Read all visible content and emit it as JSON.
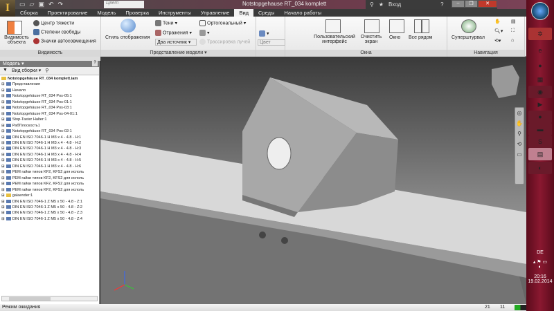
{
  "titlebar": {
    "app_icon": "I",
    "title": "Notstopgehause RT_034 komplett",
    "qat_combo": "Цвет",
    "help_search": "Вход"
  },
  "tabs": [
    "Сборка",
    "Проектирование",
    "Модель",
    "Проверка",
    "Инструменты",
    "Управление",
    "Вид",
    "Среды",
    "Начало работы"
  ],
  "active_tab": "Вид",
  "ribbon": {
    "visibility": {
      "title": "Видимость",
      "object_vis": "Видимость объекта",
      "center": "Центр тяжести",
      "dof": "Степени свободы",
      "icons": "Значки автосовмещения"
    },
    "appearance": {
      "title": "Представление модели",
      "style": "Стиль отображения",
      "shadows": "Тени",
      "reflections": "Отражения",
      "lights": "Два источник",
      "ortho": "Ортогональный",
      "raytrace": "Трассировка лучей",
      "color": "Цвет"
    },
    "windows": {
      "title": "Окна",
      "ui": "Пользовательский интерфейс",
      "clean": "Очистить экран",
      "window": "Окно",
      "tile": "Все рядом"
    },
    "navigation": {
      "title": "Навигация",
      "wheel": "Суперштурвал"
    }
  },
  "browser": {
    "title": "Модель",
    "view": "Вид сборки",
    "items": [
      "Notstopgehäuse RT_034 komplett.iam",
      "Представления",
      "Начало",
      "Notstopgehäuse RT_034 Pos-05:1",
      "Notstopgehäuse RT_034 Pos-01:1",
      "Notstopgehäuse RT_034 Pos-03:1",
      "Notstopgehäuse RT_034 Pos-04-01:1",
      "Stop-Taster Halter:1",
      "РабПлоскость1",
      "Notstopgehäuse RT_034 Pos-02:1",
      "DIN EN ISO 7046-1 H M3 x 4 - 4.8 - H:1",
      "DIN EN ISO 7046-1 H M3 x 4 - 4.8 - H:2",
      "DIN EN ISO 7046-1 H M3 x 4 - 4.8 - H:3",
      "DIN EN ISO 7046-1 H M3 x 4 - 4.8 - H:4",
      "DIN EN ISO 7046-1 H M3 x 4 - 4.8 - H:5",
      "DIN EN ISO 7046-1 H M3 x 4 - 4.8 - H:6",
      "PEM гайки типов KF2, KFS2 для исполь",
      "PEM гайки типов KF2, KFS2 для исполь",
      "PEM гайки типов KF2, KFS2 для исполь",
      "PEM гайки типов KF2, KFS2 для исполь",
      "galaender:1",
      "DIN EN ISO 7046-1 Z M5 x 50 - 4.8 - Z:1",
      "DIN EN ISO 7046-1 Z M5 x 50 - 4.8 - Z:2",
      "DIN EN ISO 7046-1 Z M5 x 50 - 4.8 - Z:3",
      "DIN EN ISO 7046-1 Z M5 x 50 - 4.8 - Z:4"
    ]
  },
  "status": {
    "text": "Режим ожидания",
    "n1": "21",
    "n2": "11"
  },
  "tray": {
    "lang": "DE",
    "time": "20:16",
    "date": "19.02.2014"
  }
}
